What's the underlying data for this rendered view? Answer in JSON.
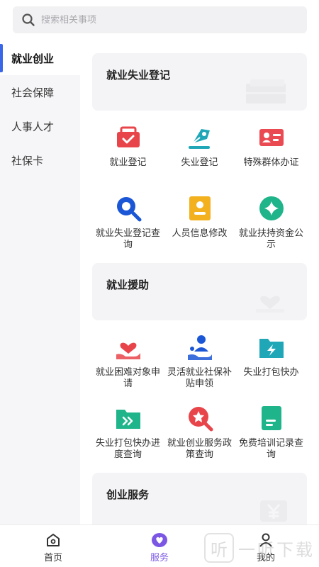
{
  "search": {
    "placeholder": "搜索相关事项"
  },
  "sidebar": {
    "items": [
      {
        "label": "就业创业",
        "active": true
      },
      {
        "label": "社会保障",
        "active": false
      },
      {
        "label": "人事人才",
        "active": false
      },
      {
        "label": "社保卡",
        "active": false
      }
    ]
  },
  "sections": [
    {
      "title": "就业失业登记",
      "tiles": [
        {
          "label": "就业登记",
          "icon": "briefcase-icon",
          "color": "#e8454a"
        },
        {
          "label": "失业登记",
          "icon": "pen-nib-icon",
          "color": "#1fa7b8"
        },
        {
          "label": "特殊群体办证",
          "icon": "id-card-icon",
          "color": "#ea4a52"
        },
        {
          "label": "就业失业登记查询",
          "icon": "magnifier-icon",
          "color": "#1a56d6"
        },
        {
          "label": "人员信息修改",
          "icon": "person-card-icon",
          "color": "#f3b11f"
        },
        {
          "label": "就业扶持资金公示",
          "icon": "diamond-badge-icon",
          "color": "#1fb48a"
        }
      ]
    },
    {
      "title": "就业援助",
      "tiles": [
        {
          "label": "就业困难对象申请",
          "icon": "heart-hand-icon",
          "color": "#e8454a"
        },
        {
          "label": "灵活就业社保补贴申领",
          "icon": "person-hand-icon",
          "color": "#1a56d6"
        },
        {
          "label": "失业打包快办",
          "icon": "bolt-folder-icon",
          "color": "#1fa7b8"
        },
        {
          "label": "失业打包快办进度查询",
          "icon": "arrow-folder-icon",
          "color": "#1fb48a"
        },
        {
          "label": "就业创业服务政策查询",
          "icon": "star-search-icon",
          "color": "#e8454a"
        },
        {
          "label": "免费培训记录查询",
          "icon": "document-icon",
          "color": "#1fb48a"
        }
      ]
    },
    {
      "title": "创业服务",
      "tiles": []
    }
  ],
  "tabbar": {
    "items": [
      {
        "label": "首页",
        "icon": "home-icon",
        "active": false
      },
      {
        "label": "服务",
        "icon": "heart-service-icon",
        "active": true
      },
      {
        "label": "我的",
        "icon": "user-icon",
        "active": false
      }
    ]
  },
  "watermark": {
    "glyph": "听",
    "text": "一听下载"
  },
  "colors": {
    "accent": "#3a66e8",
    "tab_active": "#7b57e4"
  }
}
